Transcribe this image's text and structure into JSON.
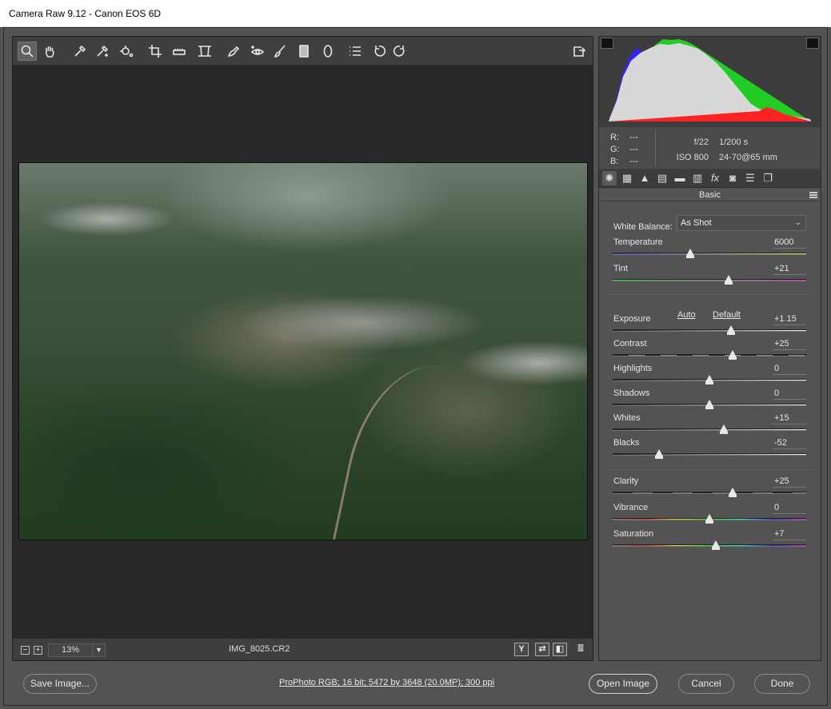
{
  "window": {
    "title": "Camera Raw 9.12  -  Canon EOS 6D"
  },
  "toolbar": {
    "tools": [
      "zoom-icon",
      "hand-icon",
      "eyedropper-icon",
      "color-sampler-icon",
      "target-adjust-icon",
      "crop-icon",
      "straighten-icon",
      "transform-icon",
      "spot-removal-icon",
      "red-eye-icon",
      "adjustment-brush-icon",
      "graduated-filter-icon",
      "radial-filter-icon",
      "preferences-icon",
      "rotate-left-icon",
      "rotate-right-icon"
    ],
    "fullscreen": "fullscreen-icon"
  },
  "preview": {
    "zoom": "13%",
    "zoom_minus": "−",
    "zoom_plus": "+",
    "filename": "IMG_8025.CR2",
    "view_buttons": [
      "Y",
      "⇄",
      "◧",
      "≣"
    ]
  },
  "histogram": {
    "colors": {
      "background": "#3c3c3c",
      "luminance": "#d8d8d8",
      "blue": "#3322ff",
      "yellow": "#eeee22",
      "green": "#22cc22",
      "magenta": "#ff33ff",
      "red": "#ff2222"
    }
  },
  "readout": {
    "r_label": "R:",
    "r_value": "---",
    "g_label": "G:",
    "g_value": "---",
    "b_label": "B:",
    "b_value": "---",
    "aperture": "f/22",
    "shutter": "1/200 s",
    "iso": "ISO 800",
    "lens": "24-70@65 mm"
  },
  "panel": {
    "tabs": [
      "basic-icon",
      "tone-curve-icon",
      "detail-icon",
      "hsl-icon",
      "split-toning-icon",
      "lens-corrections-icon",
      "effects-icon",
      "camera-calibration-icon",
      "presets-icon",
      "snapshots-icon"
    ],
    "section_title": "Basic",
    "white_balance_label": "White Balance:",
    "white_balance_value": "As Shot",
    "auto_label": "Auto",
    "default_label": "Default",
    "sliders": {
      "temperature": {
        "label": "Temperature",
        "value": "6000",
        "position": 0.4
      },
      "tint": {
        "label": "Tint",
        "value": "+21",
        "position": 0.6
      },
      "exposure": {
        "label": "Exposure",
        "value": "+1.15",
        "position": 0.61
      },
      "contrast": {
        "label": "Contrast",
        "value": "+25",
        "position": 0.62
      },
      "highlights": {
        "label": "Highlights",
        "value": "0",
        "position": 0.5
      },
      "shadows": {
        "label": "Shadows",
        "value": "0",
        "position": 0.5
      },
      "whites": {
        "label": "Whites",
        "value": "+15",
        "position": 0.575
      },
      "blacks": {
        "label": "Blacks",
        "value": "-52",
        "position": 0.24
      },
      "clarity": {
        "label": "Clarity",
        "value": "+25",
        "position": 0.62
      },
      "vibrance": {
        "label": "Vibrance",
        "value": "0",
        "position": 0.5
      },
      "saturation": {
        "label": "Saturation",
        "value": "+7",
        "position": 0.535
      }
    }
  },
  "footer": {
    "save_label": "Save Image...",
    "workflow_link": "ProPhoto RGB; 16 bit; 5472 by 3648 (20.0MP); 300 ppi",
    "open_label": "Open Image",
    "cancel_label": "Cancel",
    "done_label": "Done"
  }
}
